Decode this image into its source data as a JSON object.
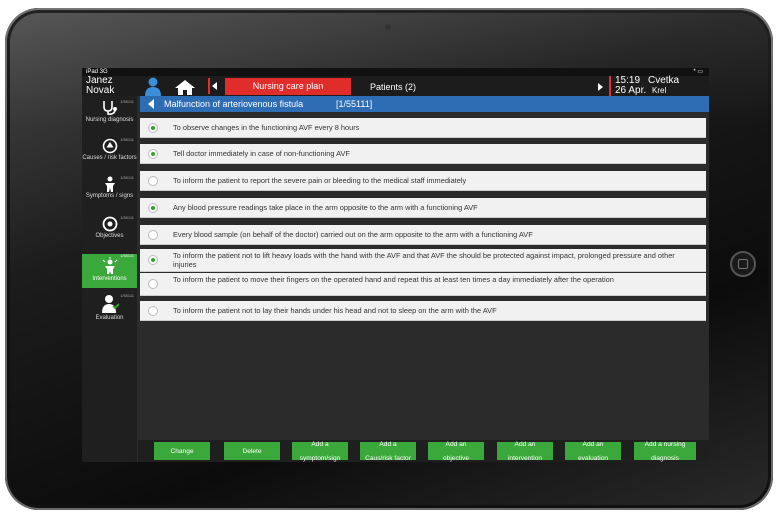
{
  "status": {
    "left": "iPad 3G",
    "right": "* ▭"
  },
  "patient": {
    "first": "Janez",
    "last": "Novak"
  },
  "nav": {
    "tab_active": "Nursing care plan",
    "tab_patients": "Patients (2)"
  },
  "datetime": {
    "time": "15:19",
    "date": "26 Apr."
  },
  "nurse": {
    "first": "Cvetka",
    "last": "Krel"
  },
  "sidebar": {
    "items": [
      {
        "label": "Nursing diagnosis",
        "num": "1/55111",
        "icon": "stethoscope-icon"
      },
      {
        "label": "Causes / risk factors",
        "num": "1/55111",
        "icon": "up-arrow-circle-icon"
      },
      {
        "label": "Symptoms / signs",
        "num": "1/55111",
        "icon": "symptoms-person-icon"
      },
      {
        "label": "Objectives",
        "num": "1/55111",
        "icon": "target-icon"
      },
      {
        "label": "Interventions",
        "num": "1/55111",
        "icon": "alert-person-icon",
        "active": true
      },
      {
        "label": "Evaluation",
        "num": "1/55111",
        "icon": "evaluation-person-icon"
      }
    ]
  },
  "header": {
    "title": "Malfunction of arteriovenous fistula",
    "code": "[1/55111]"
  },
  "items": [
    {
      "text": "To observe changes in the functioning AVF every 8 hours",
      "checked": true
    },
    {
      "text": "Tell doctor immediately in case of non-functioning AVF",
      "checked": true
    },
    {
      "text": "To inform the patient to report the severe pain or bleeding to the medical staff immediately",
      "checked": false
    },
    {
      "text": "Any blood pressure readings take place in the arm opposite to the arm with a functioning AVF",
      "checked": true
    },
    {
      "text": "Every blood sample (on behalf of the doctor) carried out on the arm opposite to the arm with a functioning AVF",
      "checked": false
    },
    {
      "text": "To inform the patient not to lift heavy loads with the hand with the AVF and that AVF the should be protected against impact, prolonged pressure and other injuries",
      "checked": true
    },
    {
      "text": "To inform the patient to move their fingers on the operated hand and repeat this at least ten times a day immediately after the operation",
      "checked": false
    },
    {
      "text": "To inform the patient not to lay their hands under his head and not to sleep on the arm with the AVF",
      "checked": false
    }
  ],
  "buttons": [
    {
      "l1": "Change",
      "l2": ""
    },
    {
      "l1": "Delete",
      "l2": ""
    },
    {
      "l1": "Add a",
      "l2": "symptom/sign"
    },
    {
      "l1": "Add a",
      "l2": "Caus/risk factor"
    },
    {
      "l1": "Add an",
      "l2": "objective"
    },
    {
      "l1": "Add an",
      "l2": "intervention"
    },
    {
      "l1": "Add an",
      "l2": "evaluation"
    },
    {
      "l1": "Add a nursing",
      "l2": "diagnosis"
    }
  ],
  "colors": {
    "accent_red": "#e12c2c",
    "accent_green": "#3aa83a",
    "header_blue": "#2e6db4"
  }
}
